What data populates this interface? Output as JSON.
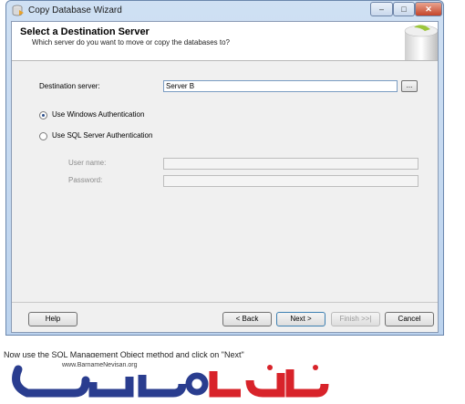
{
  "window": {
    "title": "Copy Database Wizard",
    "controls": {
      "minimize": "–",
      "maximize": "□",
      "close": "✕"
    }
  },
  "header": {
    "title": "Select a Destination Server",
    "subtitle": "Which server do you want to move or copy the databases to?"
  },
  "form": {
    "destination_label": "Destination server:",
    "destination_value": "Server B",
    "browse_label": "...",
    "auth_windows_label": "Use Windows Authentication",
    "auth_sql_label": "Use SQL Server Authentication",
    "selected_auth": "windows",
    "username_label": "User name:",
    "password_label": "Password:"
  },
  "footer": {
    "help": "Help",
    "back": "< Back",
    "next": "Next >",
    "finish": "Finish >>|",
    "cancel": "Cancel"
  },
  "caption": "Now use the SQL Management Object method and click on \"Next\"",
  "logo": {
    "url": "www.BarnameNevisan.org",
    "colors": {
      "red": "#d8232a",
      "blue": "#2a3d8f"
    }
  }
}
